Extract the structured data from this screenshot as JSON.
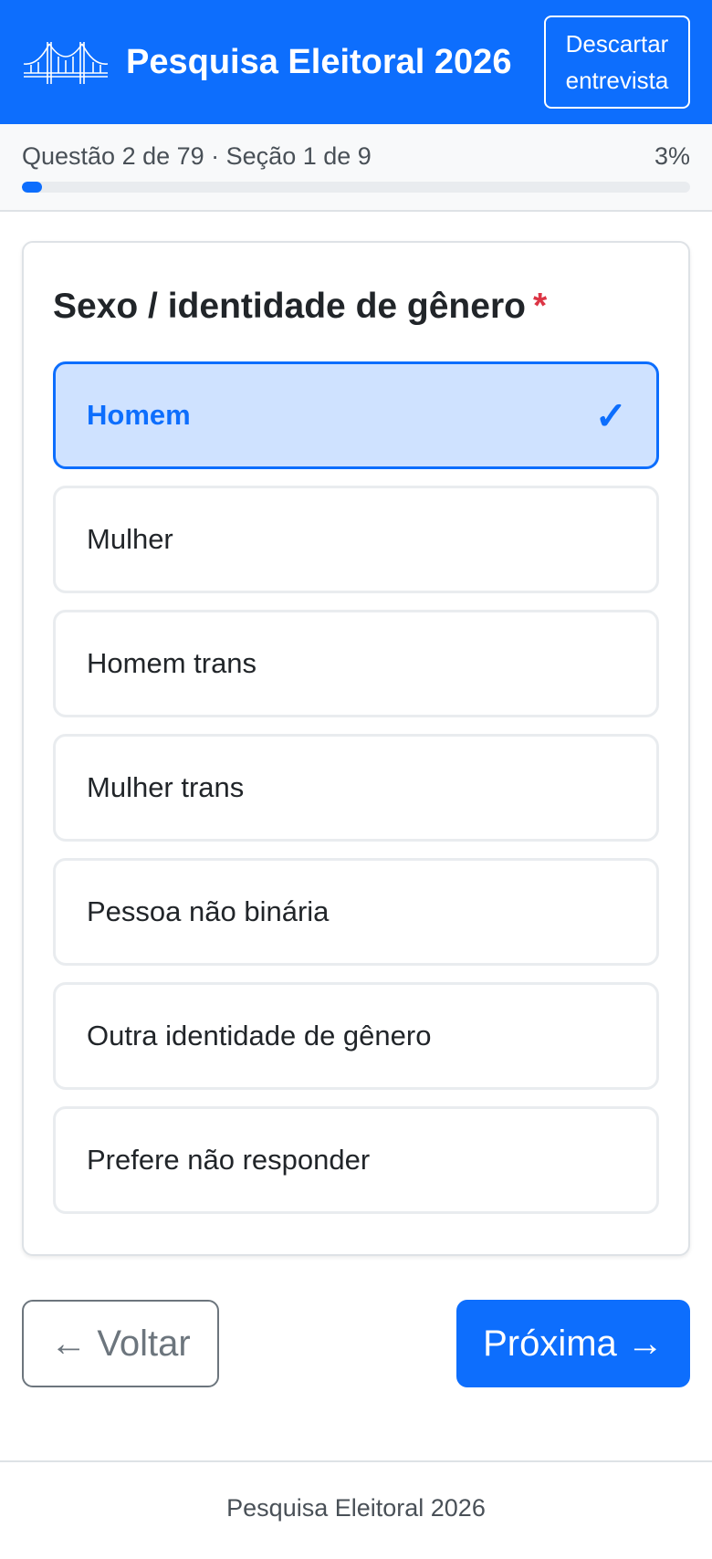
{
  "header": {
    "title": "Pesquisa Eleitoral 2026",
    "logo_icon": "bridge-icon",
    "discard_line1": "Descartar",
    "discard_line2": "entrevista",
    "background": "#0d6efd"
  },
  "progress": {
    "label": "Questão 2 de 79 · Seção 1 de 9",
    "percent_text": "3%",
    "fraction": 0.03
  },
  "question": {
    "title": "Sexo / identidade de gênero",
    "required_mark": "*",
    "options": [
      {
        "label": "Homem",
        "selected": true
      },
      {
        "label": "Mulher",
        "selected": false
      },
      {
        "label": "Homem trans",
        "selected": false
      },
      {
        "label": "Mulher trans",
        "selected": false
      },
      {
        "label": "Pessoa não binária",
        "selected": false
      },
      {
        "label": "Outra identidade de gênero",
        "selected": false
      },
      {
        "label": "Prefere não responder",
        "selected": false
      }
    ],
    "selected_icon": "checkmark-icon",
    "check_glyph": "✓"
  },
  "nav": {
    "back_label": "← Voltar",
    "next_label": "Próxima →"
  },
  "footer": {
    "text": "Pesquisa Eleitoral 2026"
  },
  "colors": {
    "primary": "#0d6efd",
    "selected_bg": "#cfe2ff",
    "required": "#dc3545"
  }
}
